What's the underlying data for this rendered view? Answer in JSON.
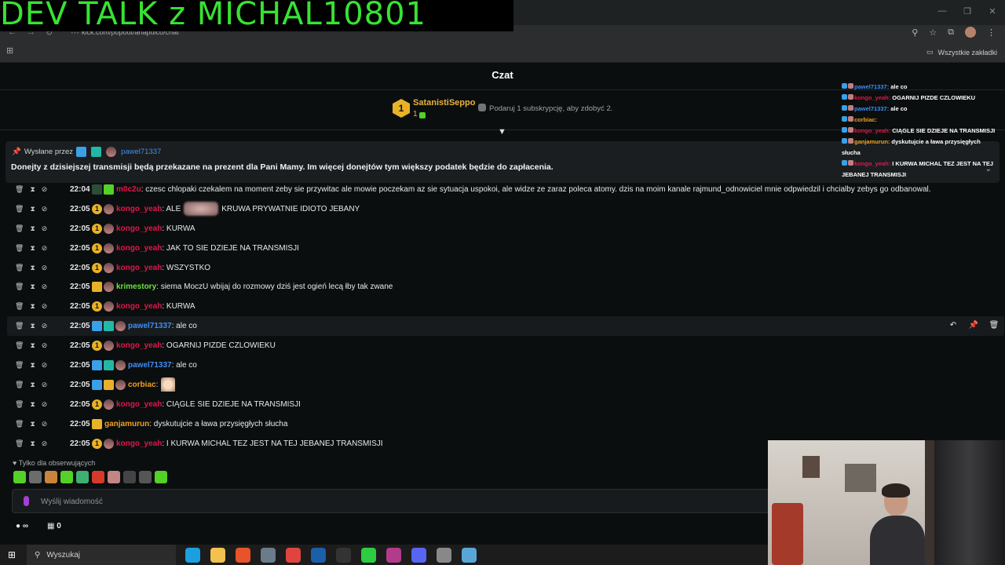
{
  "overlay": {
    "title": "DEV TALK  z MICHAL10801"
  },
  "browser": {
    "url": "kick.com/popout/anapulco/chat",
    "bookmarks_label": "Wszystkie zakładki"
  },
  "chat": {
    "header": "Czat",
    "top_gifter": {
      "rank": "1",
      "name": "SatanistiSeppo",
      "count": "1"
    },
    "gift_cta": "Podaruj 1 subskrypcję, aby zdobyć 2.",
    "pinned": {
      "sent_by_label": "Wysłane przez",
      "user": "pawel71337",
      "text": "Donejty z dzisiejszej transmisji będą przekazane na prezent dla Pani Mamy. Im więcej donejtów tym większy podatek będzie do zapłacenia."
    },
    "messages": [
      {
        "time": "22:04",
        "user": "m0c2u",
        "color": "#e0174a",
        "badges": [
          "dark",
          "green"
        ],
        "text": ": czesc chlopaki czekalem na moment zeby sie przywitac ale mowie poczekam az sie sytuacja uspokoi, ale widze ze zaraz poleca atomy. dzis na moim kanale rajmund_odnowiciel mnie odpwiedzil i chcialby zebys go odbanowal."
      },
      {
        "time": "22:05",
        "user": "kongo_yeah",
        "color": "#e0174a",
        "badges": [
          "gold",
          "ava"
        ],
        "text": ": ALE",
        "text2": "KRUWA PRYWATNIE IDIOTO JEBANY",
        "blur": true
      },
      {
        "time": "22:05",
        "user": "kongo_yeah",
        "color": "#e0174a",
        "badges": [
          "gold",
          "ava"
        ],
        "text": ": KURWA"
      },
      {
        "time": "22:05",
        "user": "kongo_yeah",
        "color": "#e0174a",
        "badges": [
          "gold",
          "ava"
        ],
        "text": ": JAK TO SIE DZIEJE NA TRANSMISJI"
      },
      {
        "time": "22:05",
        "user": "kongo_yeah",
        "color": "#e0174a",
        "badges": [
          "gold",
          "ava"
        ],
        "text": ": WSZYSTKO"
      },
      {
        "time": "22:05",
        "user": "krimestory",
        "color": "#6be33a",
        "badges": [
          "crown",
          "ava"
        ],
        "text": ": siema MoczU wbijaj do rozmowy dziś jest ogień lecą łby tak zwane"
      },
      {
        "time": "22:05",
        "user": "kongo_yeah",
        "color": "#e0174a",
        "badges": [
          "gold",
          "ava"
        ],
        "text": ": KURWA"
      },
      {
        "time": "22:05",
        "user": "pawel71337",
        "color": "#3d8ff5",
        "badges": [
          "sword",
          "sub",
          "ava"
        ],
        "text": ": ale co",
        "highlight": true
      },
      {
        "time": "22:05",
        "user": "kongo_yeah",
        "color": "#e0174a",
        "badges": [
          "gold",
          "ava"
        ],
        "text": ": OGARNIJ PIZDE CZLOWIEKU"
      },
      {
        "time": "22:05",
        "user": "pawel71337",
        "color": "#3d8ff5",
        "badges": [
          "sword",
          "sub",
          "ava"
        ],
        "text": ": ale co"
      },
      {
        "time": "22:05",
        "user": "corbiac",
        "color": "#f0a020",
        "badges": [
          "sword",
          "crown",
          "ava"
        ],
        "text": ":",
        "emoji": true
      },
      {
        "time": "22:05",
        "user": "kongo_yeah",
        "color": "#e0174a",
        "badges": [
          "gold",
          "ava"
        ],
        "text": ": CIĄGLE SIE DZIEJE NA TRANSMISJI"
      },
      {
        "time": "22:05",
        "user": "ganjamurun",
        "color": "#f0a020",
        "badges": [
          "crown"
        ],
        "text": ": dyskutujcie a ława przysięgłych słucha"
      },
      {
        "time": "22:05",
        "user": "kongo_yeah",
        "color": "#e0174a",
        "badges": [
          "gold",
          "ava"
        ],
        "text": ": I KURWA MICHAL TEZ JEST NA TEJ JEBANEJ TRANSMISJI"
      }
    ],
    "follow_only": "Tylko dla obserwujących",
    "input_placeholder": "Wyślij wiadomość",
    "points": "0",
    "infinity": "∞"
  },
  "overlay_chat": [
    {
      "user": "pawel71337:",
      "color": "#3d8ff5",
      "text": "ale co"
    },
    {
      "user": "kongo_yeah:",
      "color": "#e0174a",
      "text": "OGARNIJ PIZDE CZLOWIEKU"
    },
    {
      "user": "pawel71337:",
      "color": "#3d8ff5",
      "text": "ale co"
    },
    {
      "user": "corbiac:",
      "color": "#f0a020",
      "text": ""
    },
    {
      "user": "kongo_yeah:",
      "color": "#e0174a",
      "text": "CIĄGLE SIE DZIEJE NA TRANSMISJI"
    },
    {
      "user": "ganjamurun:",
      "color": "#f0a020",
      "text": "dyskutujcie a ława przysięgłych słucha"
    },
    {
      "user": "kongo_yeah:",
      "color": "#e0174a",
      "text": "I KURWA MICHAL TEZ JEST NA TEJ JEBANEJ TRANSMISJI"
    }
  ],
  "taskbar": {
    "search_label": "Wyszukaj",
    "apps": [
      "edge",
      "files",
      "brave",
      "notepad",
      "chrome",
      "steam",
      "obs",
      "play",
      "apps",
      "discord",
      "settings",
      "notes"
    ]
  }
}
